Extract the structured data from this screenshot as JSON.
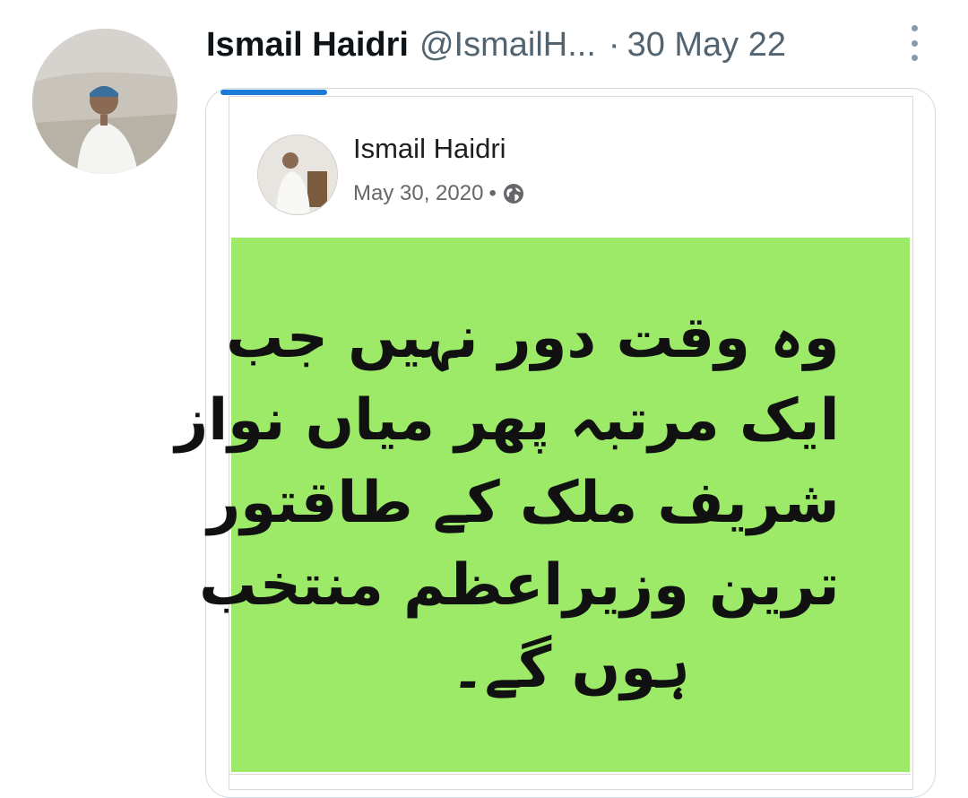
{
  "tweet": {
    "author_name": "Ismail Haidri",
    "handle": "@IsmailH...",
    "separator": "·",
    "date": "30 May 22",
    "avatar_icon": "profile-photo",
    "more_icon": "more-vertical-icon"
  },
  "embedded_post": {
    "author_name": "Ismail Haidri",
    "date": "May 30, 2020",
    "separator": "•",
    "privacy_icon": "globe-icon",
    "background_color": "#9cea68",
    "text_lines": [
      "وہ وقت دور نہیں جب",
      "ایک مرتبہ پھر میاں نواز",
      "شریف ملک کے طاقتور",
      "ترین وزیراعظم منتخب",
      "ہوں گے۔"
    ]
  },
  "colors": {
    "accent": "#1d7bd8",
    "name": "#0f1419",
    "secondary": "#536471"
  }
}
